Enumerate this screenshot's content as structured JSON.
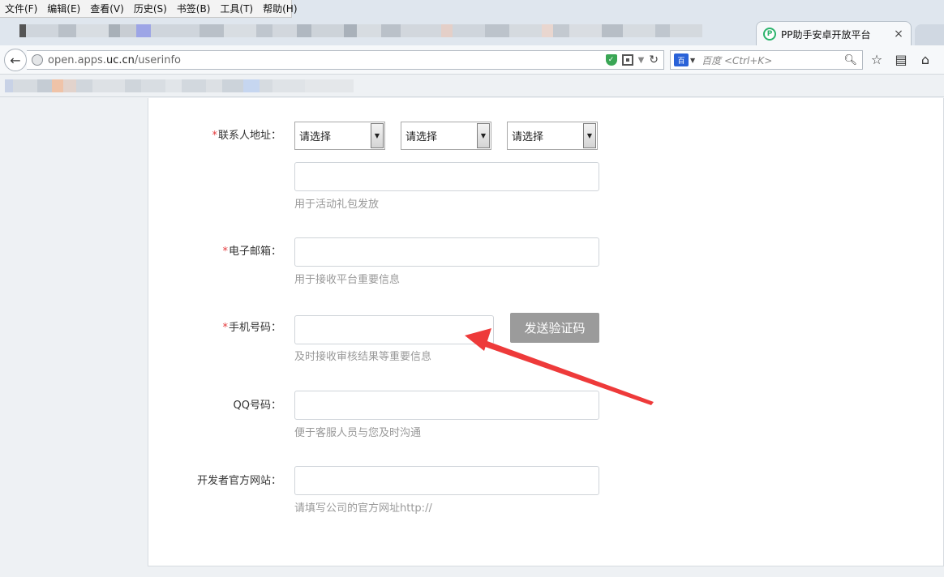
{
  "menu": {
    "items": [
      "文件(F)",
      "编辑(E)",
      "查看(V)",
      "历史(S)",
      "书签(B)",
      "工具(T)",
      "帮助(H)"
    ]
  },
  "tab": {
    "logo": "P",
    "title": "PP助手安卓开放平台",
    "close": "×"
  },
  "nav": {
    "back": "←",
    "url_prefix": "open.apps.",
    "url_domain": "uc.cn",
    "url_path": "/userinfo",
    "search_engine": "百",
    "search_placeholder": "百度 <Ctrl+K>",
    "icons": [
      "shield-icon",
      "qr-icon",
      "reload-icon",
      "star-icon",
      "clipboard-icon",
      "home-icon"
    ]
  },
  "form": {
    "address": {
      "label": "联系人地址：",
      "selects": [
        "请选择",
        "请选择",
        "请选择"
      ],
      "hint": "用于活动礼包发放"
    },
    "email": {
      "label": "电子邮箱：",
      "hint": "用于接收平台重要信息"
    },
    "phone": {
      "label": "手机号码：",
      "send_button": "发送验证码",
      "hint": "及时接收审核结果等重要信息"
    },
    "qq": {
      "label": "QQ号码：",
      "hint": "便于客服人员与您及时沟通"
    },
    "website": {
      "label": "开发者官方网站：",
      "hint": "请填写公司的官方网址http://"
    },
    "required_mark": "*"
  },
  "colors": {
    "required": "#e4393c",
    "arrow": "#ee3a3a",
    "button": "#9b9b9b"
  }
}
